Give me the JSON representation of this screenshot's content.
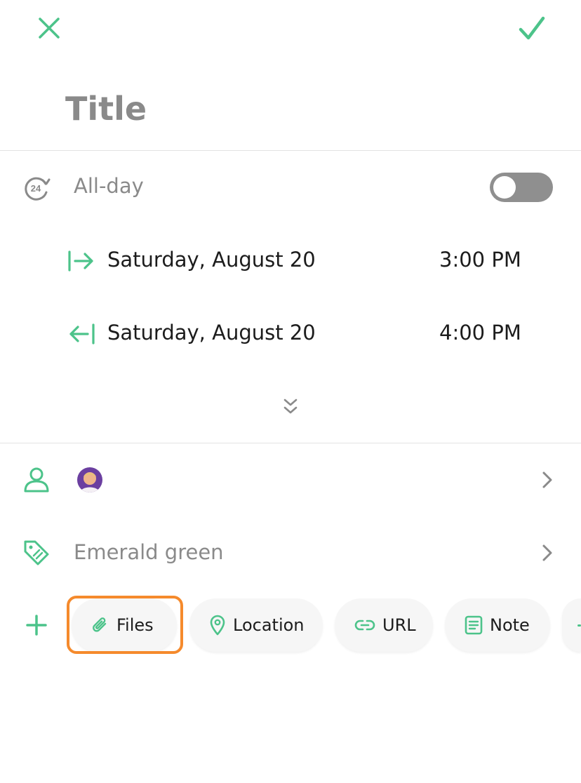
{
  "header": {
    "close_icon": "close-icon",
    "confirm_icon": "check-icon"
  },
  "title": {
    "placeholder": "Title"
  },
  "allday": {
    "icon": "24h-icon",
    "label": "All-day",
    "enabled": false
  },
  "start": {
    "icon": "arrow-right-to-bar-icon",
    "date": "Saturday, August 20",
    "time": "3:00 PM"
  },
  "end": {
    "icon": "arrow-left-from-bar-icon",
    "date": "Saturday, August 20",
    "time": "4:00 PM"
  },
  "expand": {
    "icon": "double-chevron-down-icon"
  },
  "participants": {
    "icon": "person-icon",
    "avatar": "avatar"
  },
  "color": {
    "icon": "tag-icon",
    "label": "Emerald green"
  },
  "chips": [
    {
      "icon": "paperclip-icon",
      "label": "Files"
    },
    {
      "icon": "location-pin-icon",
      "label": "Location"
    },
    {
      "icon": "link-icon",
      "label": "URL"
    },
    {
      "icon": "note-icon",
      "label": "Note"
    }
  ],
  "colors": {
    "accent": "#4cc38a",
    "muted": "#8a8a8a",
    "highlight": "#f58a2c"
  }
}
